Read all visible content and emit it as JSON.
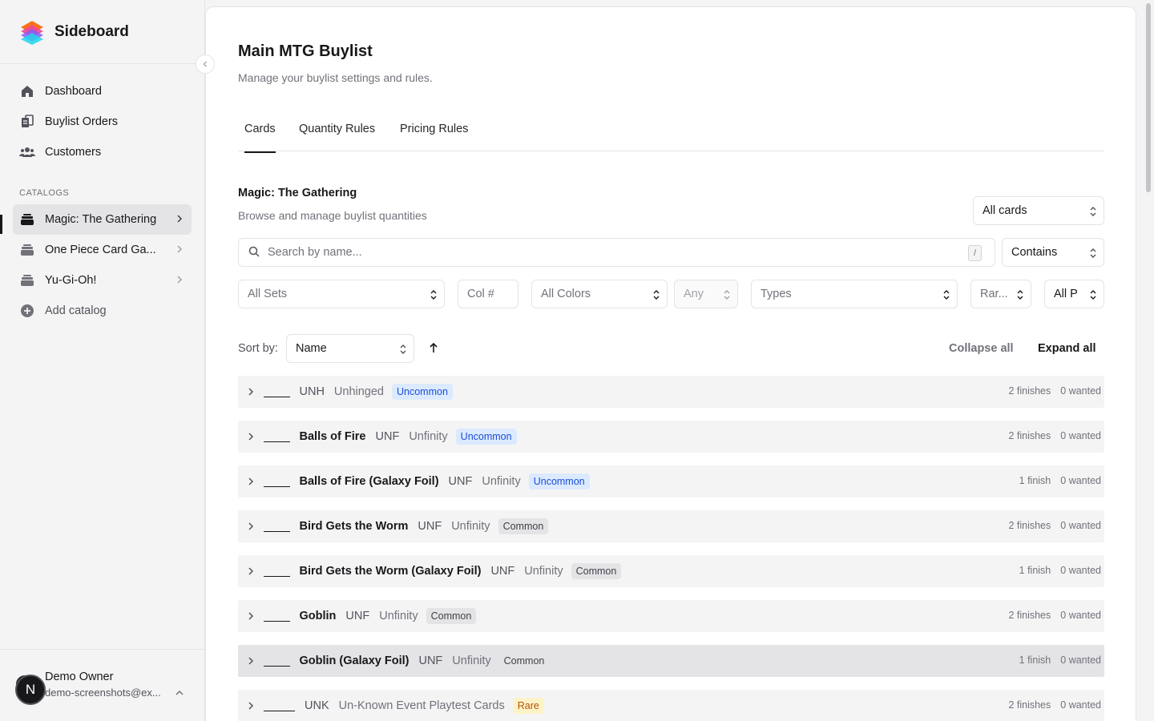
{
  "brand": {
    "name": "Sideboard"
  },
  "nav": {
    "dashboard": "Dashboard",
    "buylist_orders": "Buylist Orders",
    "customers": "Customers",
    "section_label": "CATALOGS",
    "catalog_items": [
      {
        "label": "Magic: The Gathering",
        "active": true
      },
      {
        "label": "One Piece Card Ga...",
        "active": false
      },
      {
        "label": "Yu-Gi-Oh!",
        "active": false
      }
    ],
    "add_catalog": "Add catalog"
  },
  "user": {
    "initial": "N",
    "name": "Demo Owner",
    "email": "demo-screenshots@ex..."
  },
  "page": {
    "title": "Main MTG Buylist",
    "subtitle": "Manage your buylist settings and rules."
  },
  "tabs": [
    {
      "label": "Cards",
      "active": true
    },
    {
      "label": "Quantity Rules",
      "active": false
    },
    {
      "label": "Pricing Rules",
      "active": false
    }
  ],
  "section": {
    "title": "Magic: The Gathering",
    "subtitle": "Browse and manage buylist quantities"
  },
  "filters": {
    "scope_select": "All cards",
    "search_placeholder": "Search by name...",
    "search_shortcut": "/",
    "match_select": "Contains",
    "sets": "All Sets",
    "collector_placeholder": "Col #",
    "colors": "All Colors",
    "any": "Any",
    "types": "Types",
    "rarity": "Rar...",
    "printing": "All P"
  },
  "sort": {
    "label": "Sort by:",
    "value": "Name",
    "collapse_all": "Collapse all",
    "expand_all": "Expand all"
  },
  "rarity_colors": {
    "Uncommon": {
      "bg": "#dbeafe",
      "fg": "#1d4ed8"
    },
    "Common": {
      "bg": "#e4e4e7",
      "fg": "#3f3f46"
    },
    "Rare": {
      "bg": "#fef3c7",
      "fg": "#b45309"
    }
  },
  "rows": [
    {
      "blank": "_____",
      "name": "",
      "code": "UNH",
      "set": "Unhinged",
      "rarity": "Uncommon",
      "finishes": "2 finishes",
      "wanted": "0 wanted"
    },
    {
      "blank": "_____",
      "name": "Balls of Fire",
      "code": "UNF",
      "set": "Unfinity",
      "rarity": "Uncommon",
      "finishes": "2 finishes",
      "wanted": "0 wanted"
    },
    {
      "blank": "_____",
      "name": "Balls of Fire (Galaxy Foil)",
      "code": "UNF",
      "set": "Unfinity",
      "rarity": "Uncommon",
      "finishes": "1 finish",
      "wanted": "0 wanted"
    },
    {
      "blank": "_____",
      "name": "Bird Gets the Worm",
      "code": "UNF",
      "set": "Unfinity",
      "rarity": "Common",
      "finishes": "2 finishes",
      "wanted": "0 wanted"
    },
    {
      "blank": "_____",
      "name": "Bird Gets the Worm (Galaxy Foil)",
      "code": "UNF",
      "set": "Unfinity",
      "rarity": "Common",
      "finishes": "1 finish",
      "wanted": "0 wanted"
    },
    {
      "blank": "_____",
      "name": "Goblin",
      "code": "UNF",
      "set": "Unfinity",
      "rarity": "Common",
      "finishes": "2 finishes",
      "wanted": "0 wanted"
    },
    {
      "blank": "_____",
      "name": "Goblin (Galaxy Foil)",
      "code": "UNF",
      "set": "Unfinity",
      "rarity": "Common",
      "finishes": "1 finish",
      "wanted": "0 wanted",
      "hover": true
    },
    {
      "blank": "______",
      "name": "",
      "code": "UNK",
      "set": "Un-Known Event Playtest Cards",
      "rarity": "Rare",
      "finishes": "2 finishes",
      "wanted": "0 wanted"
    }
  ]
}
